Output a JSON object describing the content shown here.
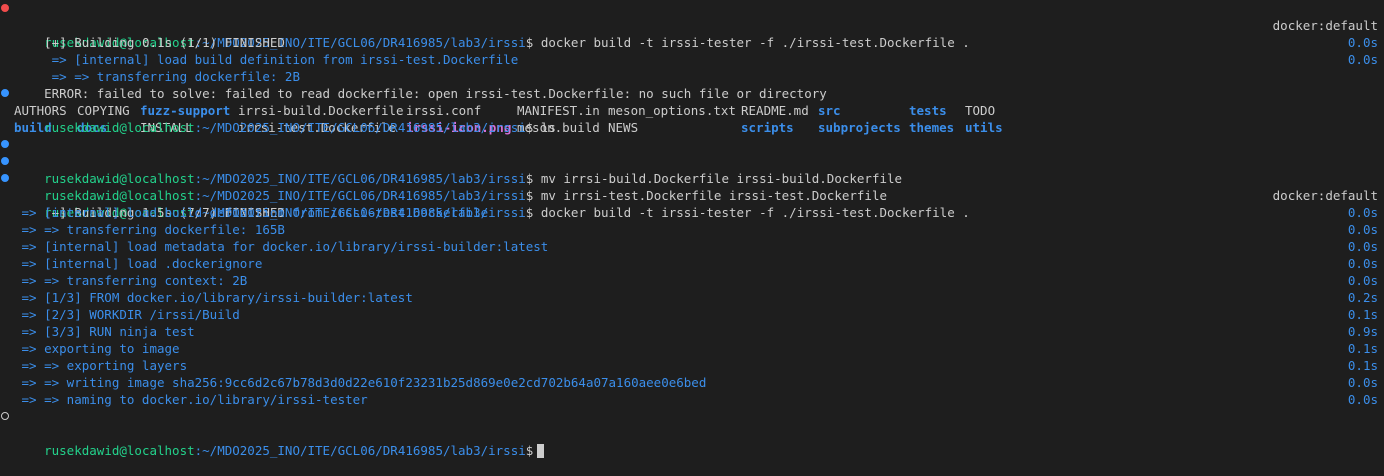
{
  "prompt": {
    "user_host": "rusekdawid@localhost",
    "path": ":~/MDO2025_INO/ITE/GCL06/DR416985/lab3/irssi",
    "symbol": "$"
  },
  "commands": {
    "build1": " docker build -t irssi-tester -f ./irssi-test.Dockerfile .",
    "ls": " ls",
    "mv1": " mv irrsi-build.Dockerfile irssi-build.Dockerfile",
    "mv2": " mv irrsi-test.Dockerfile irssi-test.Dockerfile",
    "build2": " docker build -t irssi-tester -f ./irssi-test.Dockerfile ."
  },
  "build1": {
    "header": "[+] Building 0.1s (1/1) FINISHED",
    "context": "docker:default",
    "steps": [
      {
        "text": " => [internal] load build definition from irssi-test.Dockerfile",
        "time": "0.0s"
      },
      {
        "text": " => => transferring dockerfile: 2B",
        "time": "0.0s"
      }
    ],
    "error": "ERROR: failed to solve: failed to read dockerfile: open irssi-test.Dockerfile: no such file or directory"
  },
  "ls_output": {
    "row1": [
      {
        "name": "AUTHORS",
        "type": "file",
        "w": 63
      },
      {
        "name": "COPYING",
        "type": "file",
        "w": 63
      },
      {
        "name": "fuzz-support",
        "type": "dir",
        "w": 98
      },
      {
        "name": "irrsi-build.Dockerfile",
        "type": "file",
        "w": 168
      },
      {
        "name": "irssi.conf",
        "type": "file",
        "w": 111
      },
      {
        "name": "MANIFEST.in",
        "type": "file",
        "w": 91
      },
      {
        "name": "meson_options.txt",
        "type": "file",
        "w": 133
      },
      {
        "name": "README.md",
        "type": "file",
        "w": 77
      },
      {
        "name": "src",
        "type": "dir",
        "w": 91
      },
      {
        "name": "tests",
        "type": "dir",
        "w": 56
      },
      {
        "name": "TODO",
        "type": "file",
        "w": 50
      }
    ],
    "row2": [
      {
        "name": "build",
        "type": "dir",
        "w": 63
      },
      {
        "name": "docs",
        "type": "dir",
        "w": 63
      },
      {
        "name": "INSTALL",
        "type": "file",
        "w": 98
      },
      {
        "name": "irrsi-test.Dockerfile",
        "type": "file",
        "w": 168
      },
      {
        "name": "irssi-icon.png",
        "type": "img",
        "w": 111
      },
      {
        "name": "meson.build",
        "type": "file",
        "w": 91
      },
      {
        "name": "NEWS",
        "type": "file",
        "w": 133
      },
      {
        "name": "scripts",
        "type": "dir",
        "w": 77
      },
      {
        "name": "subprojects",
        "type": "dir",
        "w": 91
      },
      {
        "name": "themes",
        "type": "dir",
        "w": 56
      },
      {
        "name": "utils",
        "type": "dir",
        "w": 50
      }
    ]
  },
  "build2": {
    "header": "[+] Building 1.5s (7/7) FINISHED",
    "context": "docker:default",
    "steps": [
      {
        "text": " => [internal] load build definition from irssi-test.Dockerfile",
        "time": "0.0s"
      },
      {
        "text": " => => transferring dockerfile: 165B",
        "time": "0.0s"
      },
      {
        "text": " => [internal] load metadata for docker.io/library/irssi-builder:latest",
        "time": "0.0s"
      },
      {
        "text": " => [internal] load .dockerignore",
        "time": "0.0s"
      },
      {
        "text": " => => transferring context: 2B",
        "time": "0.0s"
      },
      {
        "text": " => [1/3] FROM docker.io/library/irssi-builder:latest",
        "time": "0.2s"
      },
      {
        "text": " => [2/3] WORKDIR /irssi/Build",
        "time": "0.1s"
      },
      {
        "text": " => [3/3] RUN ninja test",
        "time": "0.9s"
      },
      {
        "text": " => exporting to image",
        "time": "0.1s"
      },
      {
        "text": " => => exporting layers",
        "time": "0.1s"
      },
      {
        "text": " => => writing image sha256:9cc6d2c67b78d3d0d22e610f23231b25d869e0e2cd702b64a07a160aee0e6bed",
        "time": "0.0s"
      },
      {
        "text": " => => naming to docker.io/library/irssi-tester",
        "time": "0.0s"
      }
    ]
  },
  "colors": {
    "background": "#1e1e1e",
    "foreground": "#cccccc",
    "user": "#23d18b",
    "path": "#3b8eea",
    "error_deco": "#f14c4c",
    "success_deco": "#3794ff",
    "image_file": "#d670d6"
  },
  "icons": {
    "error": "error-circle-icon",
    "success": "success-circle-icon",
    "pending": "pending-circle-icon"
  }
}
